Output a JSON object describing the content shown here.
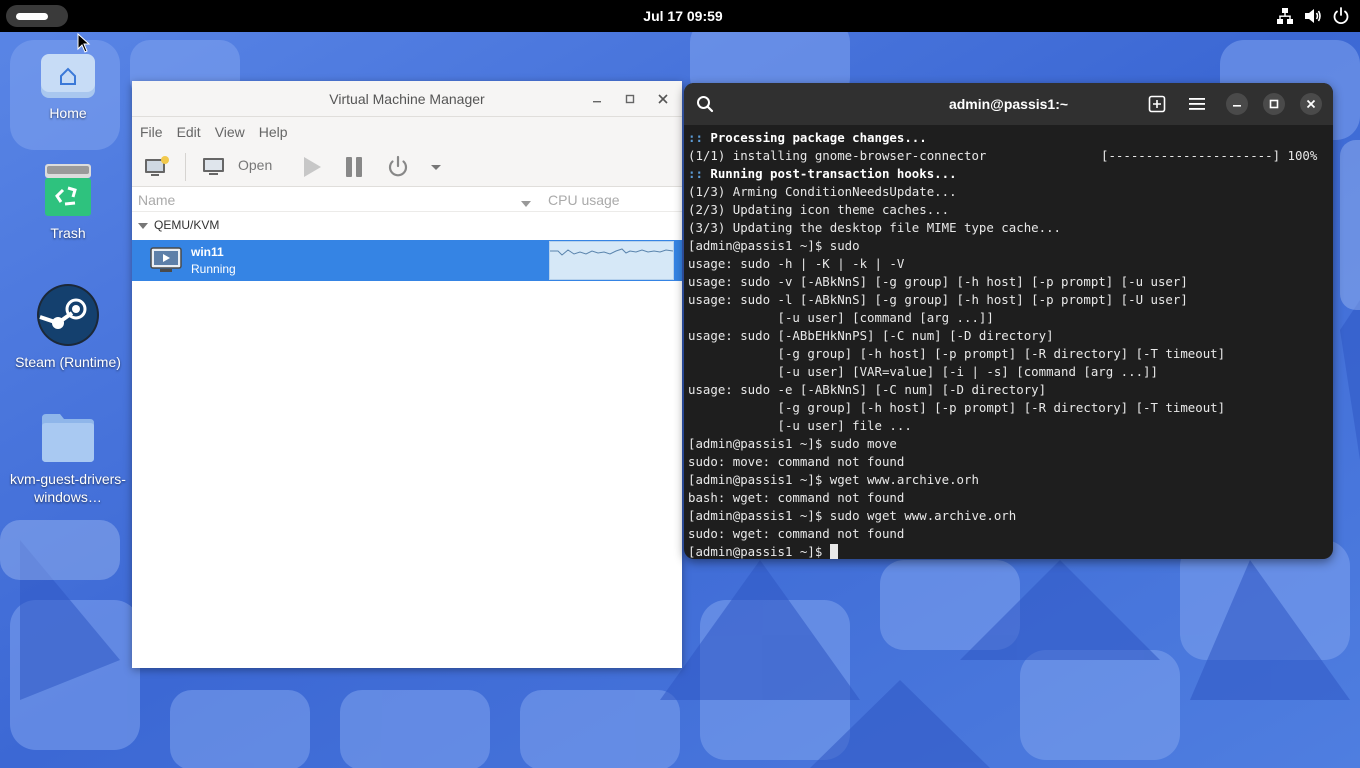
{
  "topbar": {
    "clock": "Jul 17  09:59",
    "tray_icons": [
      "network-icon",
      "volume-icon",
      "power-icon"
    ]
  },
  "desktop": {
    "icons": [
      {
        "name": "home",
        "label": "Home",
        "icon": "home-folder-icon"
      },
      {
        "name": "trash",
        "label": "Trash",
        "icon": "trash-icon"
      },
      {
        "name": "steam",
        "label": "Steam (Runtime)",
        "icon": "steam-icon"
      },
      {
        "name": "kvm-folder",
        "label": "kvm-guest-drivers-windows…",
        "icon": "folder-icon"
      }
    ]
  },
  "vmm": {
    "title": "Virtual Machine Manager",
    "menu": [
      "File",
      "Edit",
      "View",
      "Help"
    ],
    "toolbar": {
      "open_label": "Open"
    },
    "columns": {
      "name": "Name",
      "cpu": "CPU usage"
    },
    "group": "QEMU/KVM",
    "vm": {
      "name": "win11",
      "state": "Running"
    }
  },
  "terminal": {
    "title": "admin@passis1:~",
    "lines": [
      {
        "prefix": "::",
        "text": " Processing package changes...",
        "bold": true
      },
      {
        "prefix": "",
        "text": "(1/1) installing gnome-browser-connector",
        "progress": "[----------------------] 100%"
      },
      {
        "prefix": "::",
        "text": " Running post-transaction hooks...",
        "bold": true
      },
      {
        "prefix": "",
        "text": "(1/3) Arming ConditionNeedsUpdate..."
      },
      {
        "prefix": "",
        "text": "(2/3) Updating icon theme caches..."
      },
      {
        "prefix": "",
        "text": "(3/3) Updating the desktop file MIME type cache..."
      },
      {
        "prefix": "",
        "text": "[admin@passis1 ~]$ sudo"
      },
      {
        "prefix": "",
        "text": "usage: sudo -h | -K | -k | -V"
      },
      {
        "prefix": "",
        "text": "usage: sudo -v [-ABkNnS] [-g group] [-h host] [-p prompt] [-u user]"
      },
      {
        "prefix": "",
        "text": "usage: sudo -l [-ABkNnS] [-g group] [-h host] [-p prompt] [-U user]"
      },
      {
        "prefix": "",
        "text": "            [-u user] [command [arg ...]]"
      },
      {
        "prefix": "",
        "text": "usage: sudo [-ABbEHkNnPS] [-C num] [-D directory]"
      },
      {
        "prefix": "",
        "text": "            [-g group] [-h host] [-p prompt] [-R directory] [-T timeout]"
      },
      {
        "prefix": "",
        "text": "            [-u user] [VAR=value] [-i | -s] [command [arg ...]]"
      },
      {
        "prefix": "",
        "text": "usage: sudo -e [-ABkNnS] [-C num] [-D directory]"
      },
      {
        "prefix": "",
        "text": "            [-g group] [-h host] [-p prompt] [-R directory] [-T timeout]"
      },
      {
        "prefix": "",
        "text": "            [-u user] file ..."
      },
      {
        "prefix": "",
        "text": "[admin@passis1 ~]$ sudo move"
      },
      {
        "prefix": "",
        "text": "sudo: move: command not found"
      },
      {
        "prefix": "",
        "text": "[admin@passis1 ~]$ wget www.archive.orh"
      },
      {
        "prefix": "",
        "text": "bash: wget: command not found"
      },
      {
        "prefix": "",
        "text": "[admin@passis1 ~]$ sudo wget www.archive.orh"
      },
      {
        "prefix": "",
        "text": "sudo: wget: command not found"
      },
      {
        "prefix": "",
        "text": "[admin@passis1 ~]$ ",
        "cursor": true
      }
    ]
  },
  "colors": {
    "selection": "#3584e4",
    "wallpaper": "#3f6fd8",
    "terminal_bg": "#1e1e1e"
  }
}
